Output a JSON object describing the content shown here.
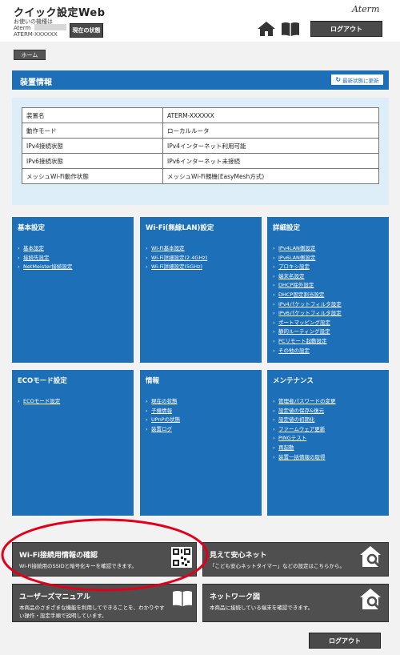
{
  "header": {
    "app_title": "クイック設定Web",
    "device_label": "お使いの機種は",
    "device_name1": "Aterm",
    "device_name2": "ATERM-XXXXXX",
    "status_button": "現在の状態",
    "brand": "Aterm",
    "logout": "ログアウト"
  },
  "breadcrumb": {
    "home": "ホーム"
  },
  "device_info": {
    "title": "装置情報",
    "refresh": "最新状態に更新",
    "rows": [
      {
        "key": "装置名",
        "value": "ATERM-XXXXXX"
      },
      {
        "key": "動作モード",
        "value": "ローカルルータ"
      },
      {
        "key": "IPv4接続状態",
        "value": "IPv4インターネット利用可能"
      },
      {
        "key": "IPv6接続状態",
        "value": "IPv6インターネット未接続"
      },
      {
        "key": "メッシュWi-Fi動作状態",
        "value": "メッシュWi-Fi親機(EasyMesh方式)"
      }
    ]
  },
  "tiles": {
    "basic": {
      "title": "基本設定",
      "links": [
        "基本設定",
        "接続先設定",
        "NetMeister接続設定"
      ]
    },
    "wifi": {
      "title": "Wi-Fi(無線LAN)設定",
      "links": [
        "Wi-Fi基本設定",
        "Wi-Fi詳細設定(2.4GHz)",
        "Wi-Fi詳細設定(5GHz)"
      ]
    },
    "advanced": {
      "title": "詳細設定",
      "links": [
        "IPv4LAN側設定",
        "IPv6LAN側設定",
        "プロキシ設定",
        "端末名設定",
        "DHCP除外設定",
        "DHCP固定割当設定",
        "IPv4パケットフィルタ設定",
        "IPv6パケットフィルタ設定",
        "ポートマッピング設定",
        "静的ルーティング設定",
        "PCリモート起動設定",
        "その他の設定"
      ]
    },
    "eco": {
      "title": "ECOモード設定",
      "links": [
        "ECOモード設定"
      ]
    },
    "info": {
      "title": "情報",
      "links": [
        "現在の状態",
        "子機情報",
        "UPnPの状態",
        "装置ログ"
      ]
    },
    "maintenance": {
      "title": "メンテナンス",
      "links": [
        "管理者パスワードの変更",
        "設定値の保存&復元",
        "設定値の初期化",
        "ファームウェア更新",
        "PINGテスト",
        "再起動",
        "装置一括情報の取得"
      ]
    }
  },
  "cards": {
    "wifi_info": {
      "title": "Wi-Fi接続用情報の確認",
      "desc": "Wi-Fi接続用のSSIDと暗号化キーを確認できます。"
    },
    "safety": {
      "title": "見えて安心ネット",
      "desc": "「こども安心ネットタイマー」などの設定はこちらから。"
    },
    "manual": {
      "title": "ユーザーズマニュアル",
      "desc": "本商品のさまざまな機能を利用してできることを、わかりやすい操作・設定手順で説明しています。"
    },
    "network": {
      "title": "ネットワーク図",
      "desc": "本商品に接続している端末を確認できます。"
    }
  },
  "colors": {
    "accent": "#1d70b7",
    "panel": "#ddeef8",
    "card": "#4f4f4f",
    "highlight": "#e0001b"
  }
}
